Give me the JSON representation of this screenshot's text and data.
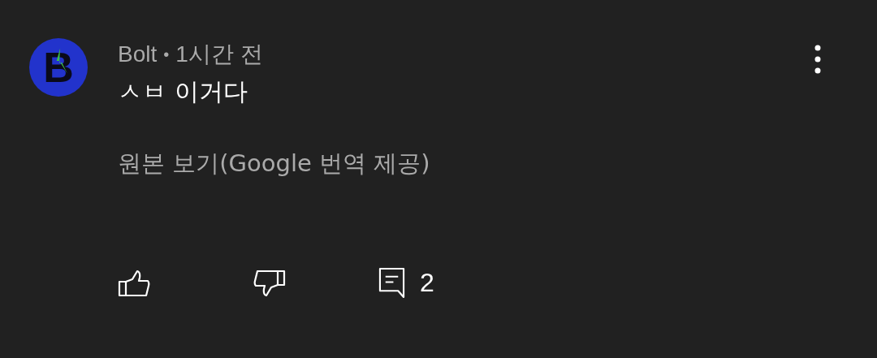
{
  "comment": {
    "avatar": {
      "letter": "B"
    },
    "author": "Bolt",
    "separator": "•",
    "time": "1시간 전",
    "text": "ㅅㅂ 이거다",
    "translation_link": "원본 보기(Google 번역 제공)",
    "reply_count": "2"
  }
}
